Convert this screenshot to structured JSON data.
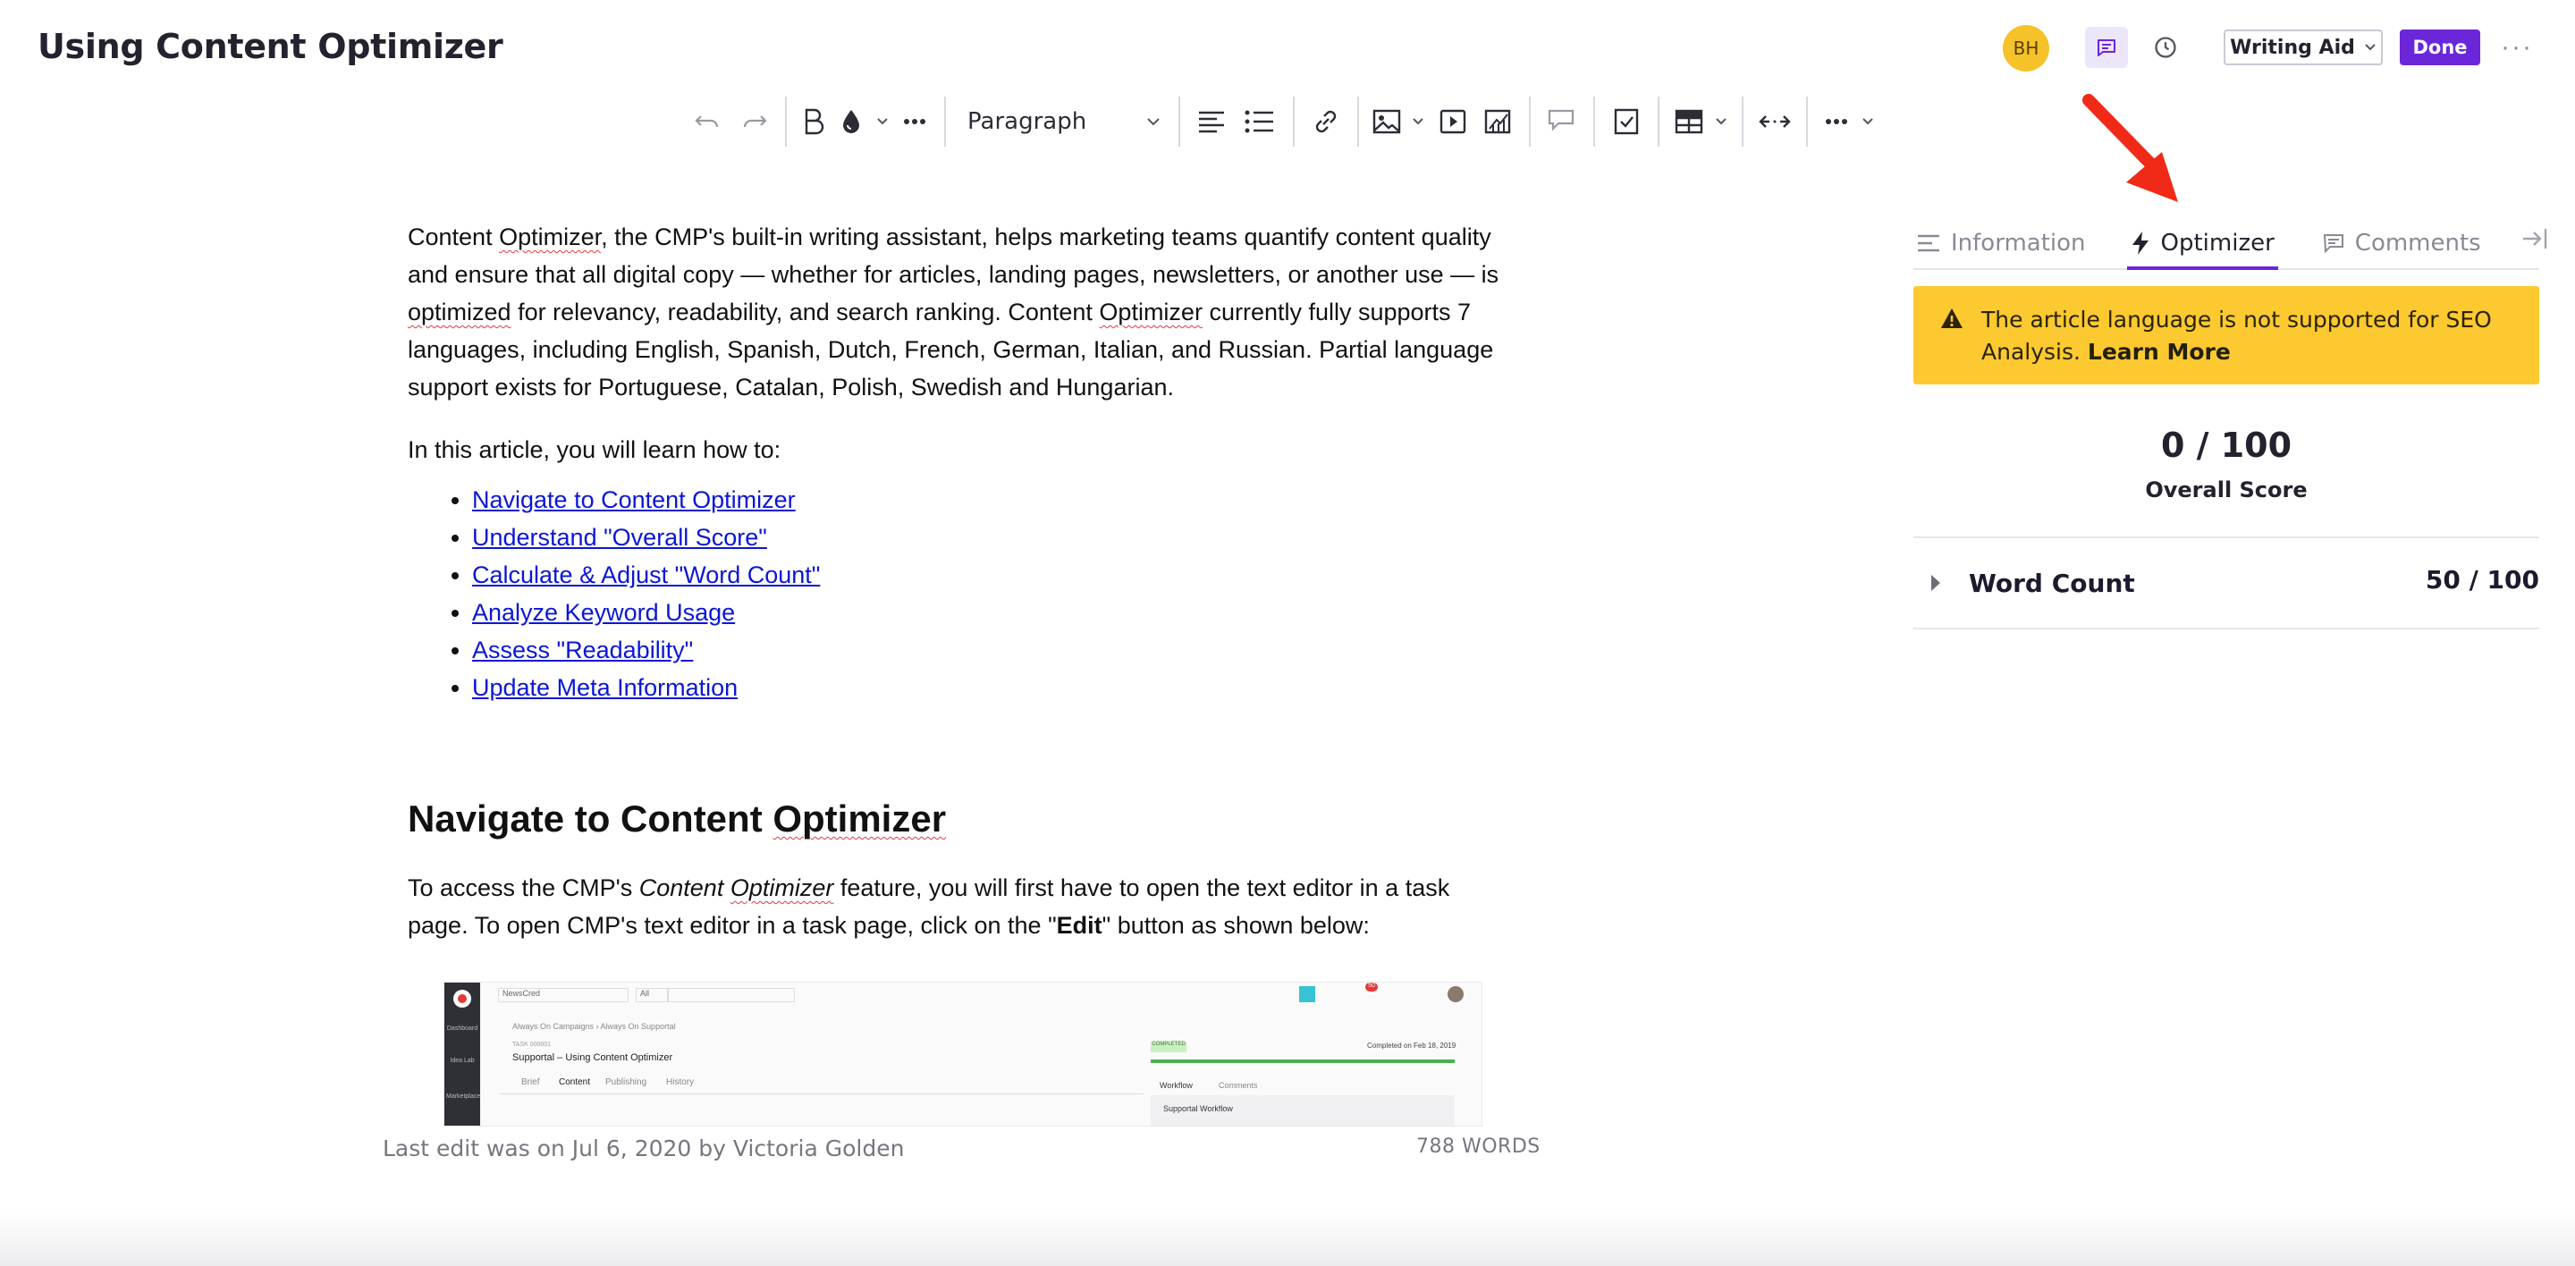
{
  "header": {
    "title": "Using Content Optimizer",
    "avatar_initials": "BH",
    "writing_aid_label": "Writing Aid",
    "done_label": "Done",
    "more_icon": "ellipsis-icon"
  },
  "toolbar": {
    "items": [
      "undo-icon",
      "redo-icon",
      "bold-icon",
      "color-drop-icon",
      "more-format-icon",
      "paragraph-select",
      "align-icon",
      "list-icon",
      "link-icon",
      "image-icon",
      "video-icon",
      "chart-icon",
      "comment-icon",
      "checklist-icon",
      "table-icon",
      "expand-icon",
      "more-icon"
    ],
    "paragraph_label": "Paragraph"
  },
  "editor": {
    "intro_1": "Content ",
    "intro_word_optimizer": "Optimizer",
    "intro_2": ", the CMP's built-in writing assistant, helps marketing teams quantify content quality and ensure that all digital copy — whether for articles, landing pages, newsletters, or another use — is ",
    "intro_word_optimized": "optimized",
    "intro_3": " for relevancy, readability, and search ranking. Content ",
    "intro_4": " currently fully supports 7 languages, including English, Spanish, Dutch, French, German, Italian, and Russian. Partial language support exists for Portuguese, Catalan, Polish, Swedish and Hungarian.",
    "learn_intro": "In this article, you will learn how to:",
    "links": [
      "Navigate to Content Optimizer",
      "Understand \"Overall Score\"",
      "Calculate & Adjust \"Word Count\"",
      "Analyze Keyword Usage",
      "Assess \"Readability\"",
      "Update Meta Information"
    ],
    "heading_1": "Navigate to Content ",
    "heading_word": "Optimizer",
    "para2_1": "To access the CMP's ",
    "para2_italic_1": "Content ",
    "para2_italic_word": "Optimizer",
    "para2_2": " feature, you will first have to open the text editor in a task page. To open CMP's text editor in a task page, click on the \"",
    "para2_bold": "Edit",
    "para2_3": "\" button as shown below:"
  },
  "embedded_screenshot": {
    "workspace": "NewsCred",
    "filter": "All",
    "breadcrumb": "Always On Campaigns › Always On Supportal",
    "task_label": "TASK 000001",
    "task_title": "Supportal – Using Content Optimizer",
    "tabs": [
      "Brief",
      "Content",
      "Publishing",
      "History"
    ],
    "status": "COMPLETED",
    "completed": "Completed on Feb 18, 2019",
    "side_tabs": [
      "Workflow",
      "Comments"
    ],
    "workflow_title": "Supportal Workflow",
    "nav": [
      "Dashboard",
      "Idea Lab",
      "Marketplace"
    ],
    "badge": "50"
  },
  "footer": {
    "last_edit": "Last edit was on Jul 6, 2020 by Victoria Golden",
    "words": "788 WORDS"
  },
  "panel": {
    "tabs": [
      {
        "label": "Information",
        "icon": "info-lines-icon",
        "active": false
      },
      {
        "label": "Optimizer",
        "icon": "bolt-icon",
        "active": true
      },
      {
        "label": "Comments",
        "icon": "comment-icon",
        "active": false
      }
    ],
    "alert_text": "The article language is not supported for SEO Analysis. ",
    "alert_link": "Learn More",
    "score": "0 / 100",
    "score_label": "Overall Score",
    "rows": [
      {
        "label": "Word Count",
        "value": "50 / 100"
      }
    ]
  },
  "colors": {
    "accent": "#6b26d9",
    "alert": "#fcc930",
    "link": "#0a16d6",
    "annotation_arrow": "#f02a17"
  }
}
